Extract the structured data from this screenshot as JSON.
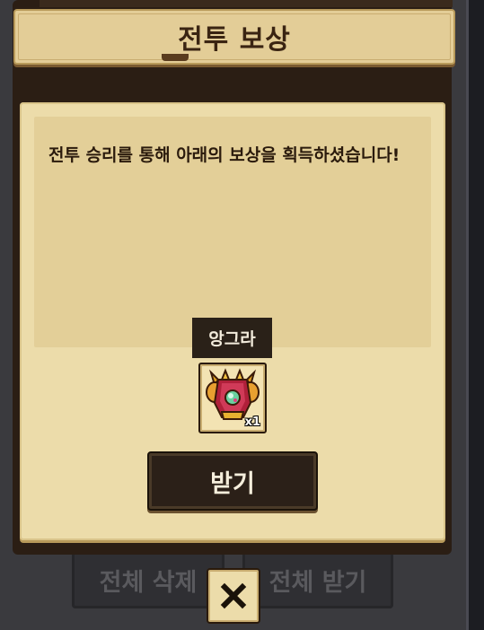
{
  "header": {
    "title": "전투 보상"
  },
  "dialog": {
    "message": "전투 승리를 통해 아래의 보상을 획득하셨습니다!",
    "reward": {
      "name": "앙그라",
      "count": "x1",
      "icon": "armor-icon"
    },
    "claim_label": "받기"
  },
  "background_buttons": {
    "delete_all": "전체 삭제",
    "receive_all": "전체 받기"
  },
  "close": {
    "icon": "close-icon"
  },
  "colors": {
    "parchment": "#ecdcaa",
    "header": "#e3cd97",
    "dark": "#2b2018"
  }
}
